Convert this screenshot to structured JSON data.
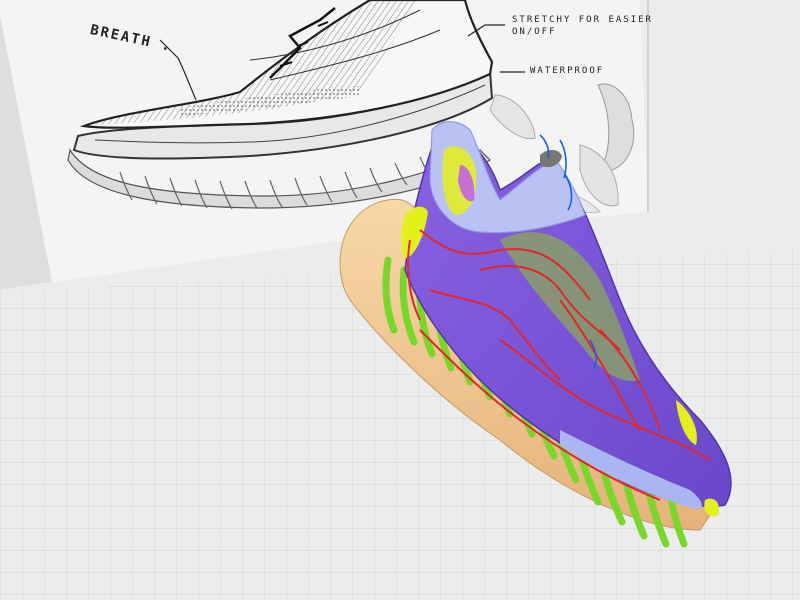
{
  "scene": {
    "annotations": {
      "breath": "BREATH .",
      "stretch_line1": "STRETCHY FOR EASIER",
      "stretch_line2": "ON/OFF",
      "waterproof": "WATERPROOF"
    },
    "colors": {
      "ground": "#e9e9e9",
      "grid_line": "#d4d4d4",
      "board": "#f2f2f2",
      "upper": "#7b57d8",
      "collar": "#b8bff0",
      "midsole": "#f1c68b",
      "tread_lugs": "#7fdd2a",
      "accent_yellow": "#e3f01b",
      "curves_red": "#e3262a",
      "curves_blue": "#1e5be0"
    },
    "icons": [
      "sketch-board",
      "shoe-3d-model",
      "ground-grid"
    ]
  }
}
